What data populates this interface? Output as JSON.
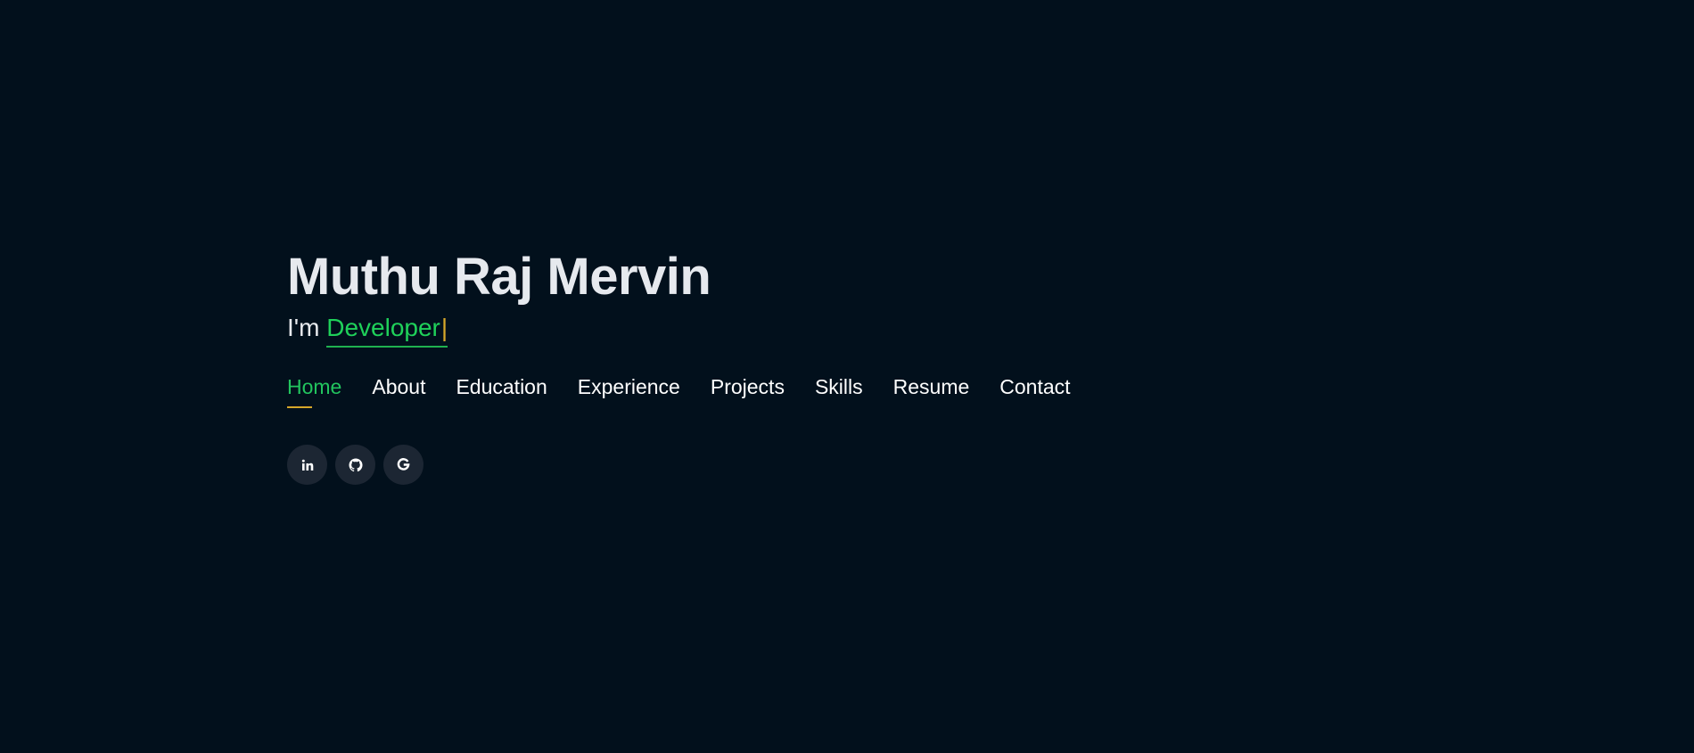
{
  "hero": {
    "name": "Muthu Raj Mervin",
    "tagline_prefix": "I'm",
    "typed_role": "Developer",
    "cursor": "|"
  },
  "nav": {
    "items": [
      {
        "label": "Home",
        "active": true
      },
      {
        "label": "About",
        "active": false
      },
      {
        "label": "Education",
        "active": false
      },
      {
        "label": "Experience",
        "active": false
      },
      {
        "label": "Projects",
        "active": false
      },
      {
        "label": "Skills",
        "active": false
      },
      {
        "label": "Resume",
        "active": false
      },
      {
        "label": "Contact",
        "active": false
      }
    ]
  },
  "social": [
    {
      "icon": "linkedin-icon"
    },
    {
      "icon": "github-icon"
    },
    {
      "icon": "google-icon"
    }
  ],
  "colors": {
    "background": "#02101c",
    "accent": "#22c55e",
    "underline_accent": "#d5a72a",
    "social_bg": "#1c2633"
  }
}
